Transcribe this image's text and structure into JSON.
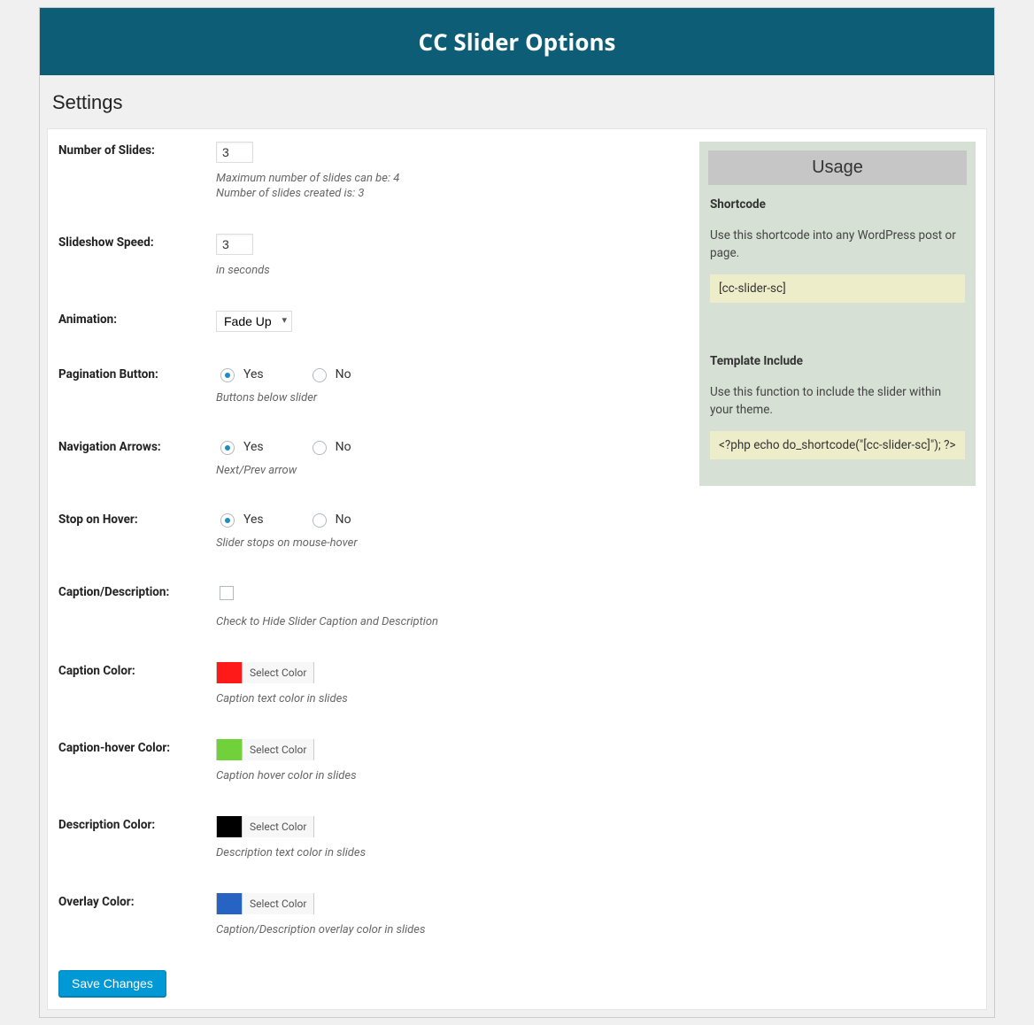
{
  "header": {
    "title": "CC Slider Options"
  },
  "settings_heading": "Settings",
  "fields": {
    "num_slides": {
      "label": "Number of Slides:",
      "value": "3",
      "hint1": "Maximum number of slides can be: 4",
      "hint2": "Number of slides created is: 3"
    },
    "speed": {
      "label": "Slideshow Speed:",
      "value": "3",
      "hint": "in seconds"
    },
    "animation": {
      "label": "Animation:",
      "value": "Fade Up"
    },
    "pagination": {
      "label": "Pagination Button:",
      "yes": "Yes",
      "no": "No",
      "hint": "Buttons below slider"
    },
    "nav_arrows": {
      "label": "Navigation Arrows:",
      "yes": "Yes",
      "no": "No",
      "hint": "Next/Prev arrow"
    },
    "stop_hover": {
      "label": "Stop on Hover:",
      "yes": "Yes",
      "no": "No",
      "hint": "Slider stops on mouse-hover"
    },
    "caption_desc": {
      "label": "Caption/Description:",
      "hint": "Check to Hide Slider Caption and Description"
    },
    "caption_color": {
      "label": "Caption Color:",
      "btn": "Select Color",
      "color": "#ff1a1a",
      "hint": "Caption text color in slides"
    },
    "caption_hover_color": {
      "label": "Caption-hover Color:",
      "btn": "Select Color",
      "color": "#71d13a",
      "hint": "Caption hover color in slides"
    },
    "description_color": {
      "label": "Description Color:",
      "btn": "Select Color",
      "color": "#000000",
      "hint": "Description text color in slides"
    },
    "overlay_color": {
      "label": "Overlay Color:",
      "btn": "Select Color",
      "color": "#2763c3",
      "hint": "Caption/Description overlay color in slides"
    }
  },
  "save_button": "Save Changes",
  "usage": {
    "title": "Usage",
    "shortcode_label": "Shortcode",
    "shortcode_text": "Use this shortcode into any WordPress post or page.",
    "shortcode_code": "[cc-slider-sc]",
    "template_label": "Template Include",
    "template_text": "Use this function to include the slider within your theme.",
    "template_code": "<?php echo do_shortcode(\"[cc-slider-sc]\"); ?>"
  }
}
